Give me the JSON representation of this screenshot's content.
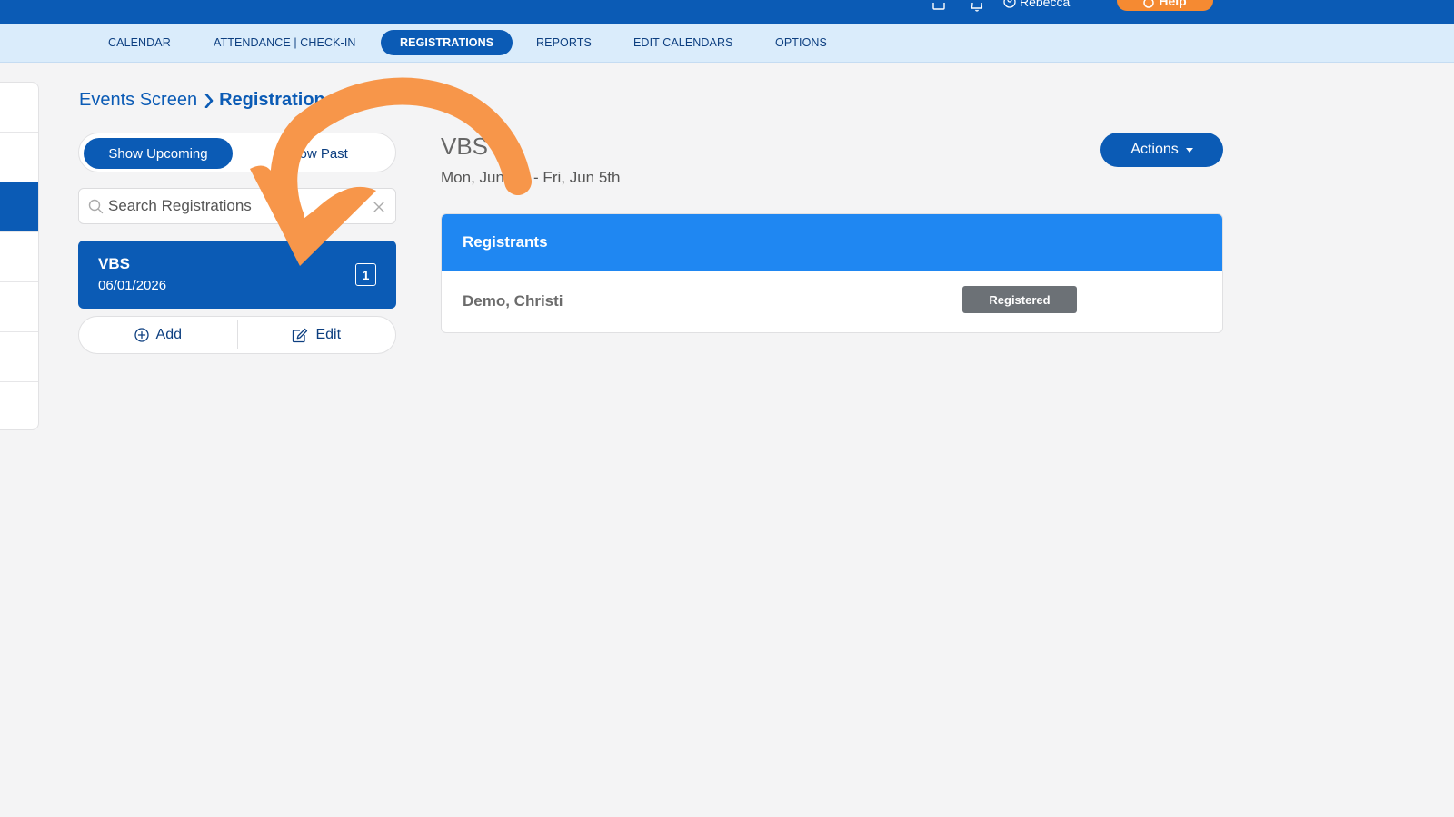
{
  "topbar": {
    "user_name": "Rebecca",
    "help_label": "Help"
  },
  "nav": {
    "items": [
      {
        "label": "CALENDAR"
      },
      {
        "label": "ATTENDANCE | CHECK-IN"
      },
      {
        "label": "REGISTRATIONS"
      },
      {
        "label": "REPORTS"
      },
      {
        "label": "EDIT CALENDARS"
      },
      {
        "label": "OPTIONS"
      }
    ],
    "active": "REGISTRATIONS"
  },
  "breadcrumb": {
    "parent": "Events Screen",
    "current": "Registrations"
  },
  "filter_toggle": {
    "upcoming_label": "Show Upcoming",
    "past_label": "Show Past"
  },
  "search": {
    "placeholder": "Search Registrations"
  },
  "events": [
    {
      "title": "VBS",
      "date": "06/01/2026",
      "count": "1"
    }
  ],
  "event_actions": {
    "add_label": "Add",
    "edit_label": "Edit"
  },
  "detail": {
    "title": "VBS",
    "date_range": "Mon, Jun 1st - Fri, Jun 5th",
    "actions_label": "Actions"
  },
  "registrants": {
    "header": "Registrants",
    "rows": [
      {
        "name": "Demo, Christi",
        "status": "Registered"
      }
    ]
  },
  "colors": {
    "brand": "#0b5bb5",
    "panel_header": "#1f87f2",
    "help": "#f58a32",
    "annotation_arrow": "#f7964a"
  }
}
